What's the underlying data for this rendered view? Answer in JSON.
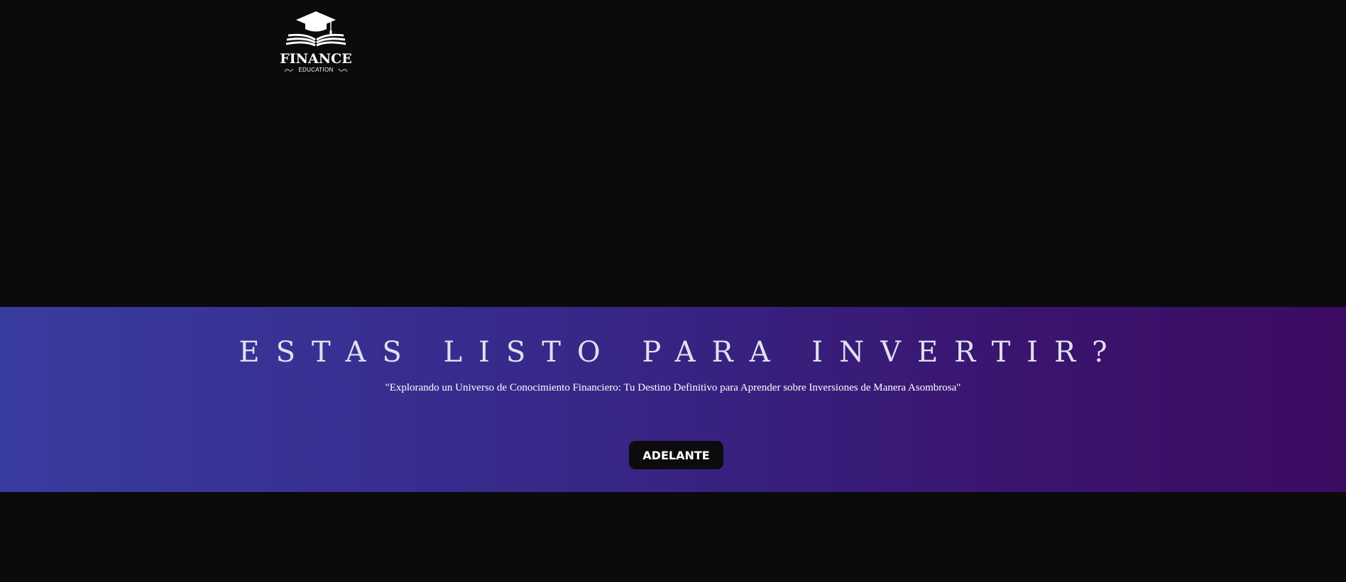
{
  "brand": {
    "logo_icon": "graduation-cap-open-book-icon",
    "name": "FINANCE",
    "tagline": "EDUCATION"
  },
  "hero": {
    "title": "ESTAS LISTO PARA INVERTIR?",
    "subtitle": "\"Explorando un Universo de Conocimiento Financiero: Tu Destino Definitivo para Aprender sobre Inversiones de Manera Asombrosa\"",
    "cta_label": "ADELANTE"
  },
  "colors": {
    "page_background": "#0b0b0d",
    "hero_gradient_start": "#393c9f",
    "hero_gradient_end": "#3c0b62",
    "title_text": "#dfe1ef",
    "button_background": "#0c0c0e",
    "button_text": "#ffffff"
  }
}
